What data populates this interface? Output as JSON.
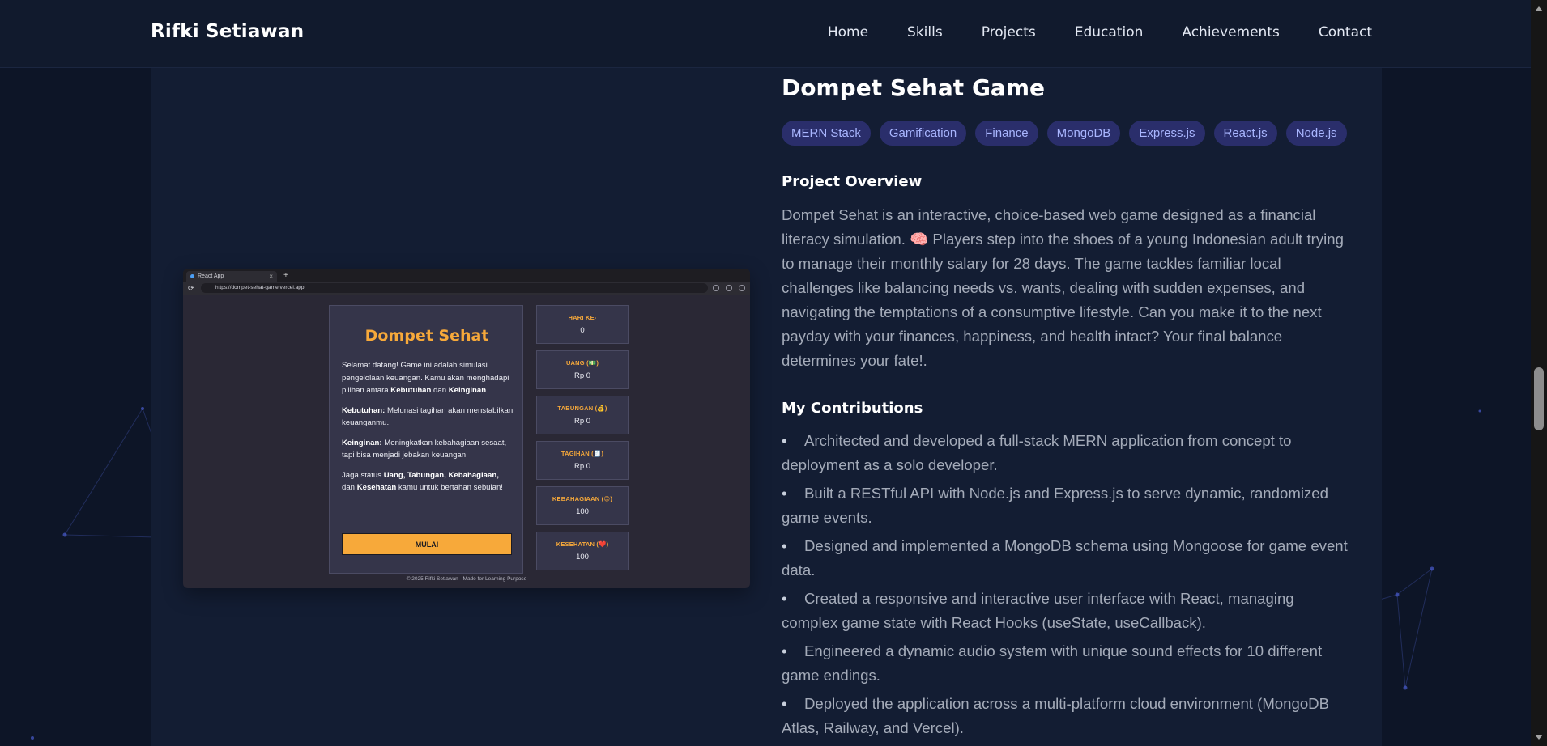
{
  "header": {
    "brand": "Rifki Setiawan",
    "nav": [
      "Home",
      "Skills",
      "Projects",
      "Education",
      "Achievements",
      "Contact"
    ]
  },
  "project": {
    "title": "Dompet Sehat Game",
    "tags": [
      "MERN Stack",
      "Gamification",
      "Finance",
      "MongoDB",
      "Express.js",
      "React.js",
      "Node.js"
    ],
    "overview_heading": "Project Overview",
    "overview": "Dompet Sehat is an interactive, choice-based web game designed as a financial literacy simulation. 🧠 Players step into the shoes of a young Indonesian adult trying to manage their monthly salary for 28 days. The game tackles familiar local challenges like balancing needs vs. wants, dealing with sudden expenses, and navigating the temptations of a consumptive lifestyle. Can you make it to the next payday with your finances, happiness, and health intact? Your final balance determines your fate!.",
    "contributions_heading": "My Contributions",
    "contributions": [
      "Architected and developed a full-stack MERN application from concept to deployment as a solo developer.",
      "Built a RESTful API with Node.js and Express.js to serve dynamic, randomized game events.",
      "Designed and implemented a MongoDB schema using Mongoose for game event data.",
      "Created a responsive and interactive user interface with React, managing complex game state with React Hooks (useState, useCallback).",
      "Engineered a dynamic audio system with unique sound effects for 10 different game endings.",
      "Deployed the application across a multi-platform cloud environment (MongoDB Atlas, Railway, and Vercel)."
    ]
  },
  "preview": {
    "tab_title": "React App",
    "url": "https://dompet-sehat-game.vercel.app",
    "game_title": "Dompet Sehat",
    "intro_pre": "Selamat datang! Game ini adalah simulasi pengelolaan keuangan. Kamu akan menghadapi pilihan antara ",
    "intro_b1": "Kebutuhan",
    "intro_mid": " dan ",
    "intro_b2": "Keinginan",
    "intro_end": ".",
    "needs_label": "Kebutuhan:",
    "needs_text": " Melunasi tagihan akan menstabilkan keuanganmu.",
    "wants_label": "Keinginan:",
    "wants_text": " Meningkatkan kebahagiaan sesaat, tapi bisa menjadi jebakan keuangan.",
    "status_pre": "Jaga status ",
    "status_b1": "Uang, Tabungan, Kebahagiaan,",
    "status_mid": " dan ",
    "status_b2": "Kesehatan",
    "status_end": " kamu untuk bertahan sebulan!",
    "start_button": "MULAI",
    "stats": [
      {
        "label": "HARI KE-",
        "value": "0"
      },
      {
        "label": "UANG (💵)",
        "value": "Rp 0"
      },
      {
        "label": "TABUNGAN (💰)",
        "value": "Rp 0"
      },
      {
        "label": "TAGIHAN (🧾)",
        "value": "Rp 0"
      },
      {
        "label": "KEBAHAGIAAN (😊)",
        "value": "100"
      },
      {
        "label": "KESEHATAN (❤️)",
        "value": "100"
      }
    ],
    "footer": "© 2025 Rifki Setiawan - Made for Learning Purpose"
  },
  "colors": {
    "background": "#0d1527",
    "card": "#131d33",
    "tag_bg": "#2a2e6b",
    "tag_text": "#a9b6ff",
    "game_accent": "#f7a93a"
  }
}
